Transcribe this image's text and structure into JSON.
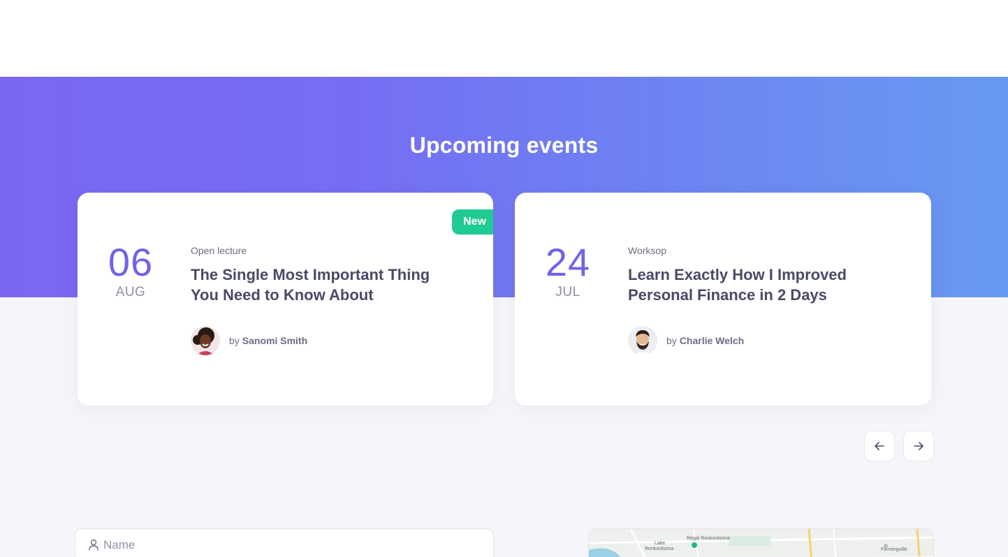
{
  "section": {
    "title": "Upcoming events"
  },
  "events": [
    {
      "day": "06",
      "month": "AUG",
      "category": "Open lecture",
      "title_line1": "The Single Most Important Thing",
      "title_line2": "You Need to Know About",
      "by": "by",
      "author": "Sanomi Smith",
      "badge": "New"
    },
    {
      "day": "24",
      "month": "JUL",
      "category": "Worksop",
      "title_line1": "Learn Exactly How I Improved",
      "title_line2": "Personal Finance in 2 Days",
      "by": "by",
      "author": "Charlie Welch"
    }
  ],
  "nav": {
    "prev_icon": "arrow-left-icon",
    "next_icon": "arrow-right-icon"
  },
  "form": {
    "name_placeholder": "Name",
    "name_icon": "user-icon"
  },
  "map": {
    "labels": [
      "Lake",
      "Ronkonkoma",
      "Regal Ronkonkoma",
      "Farmingville"
    ]
  },
  "colors": {
    "accent": "#7062ea",
    "badge": "#1fcb92",
    "gradient_start": "#7a68f2",
    "gradient_end": "#6899f2"
  }
}
